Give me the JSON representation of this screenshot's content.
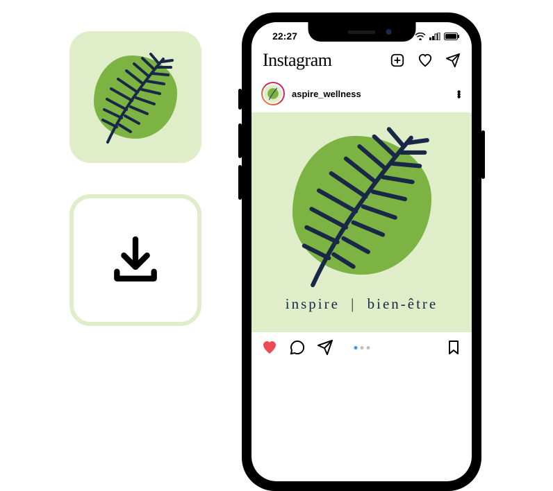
{
  "colors": {
    "tile_bg": "#dfedc9",
    "blob": "#7cb342",
    "leaf": "#1a2847",
    "heart": "#ed4956"
  },
  "logo_tile": {
    "alt": "leaf-logo"
  },
  "download_tile": {
    "label": "download"
  },
  "phone": {
    "status": {
      "time": "22:27"
    },
    "app": {
      "name": "Instagram"
    },
    "post": {
      "username": "aspire_wellness",
      "caption_left": "inspire",
      "caption_divider": "|",
      "caption_right": "bien-être",
      "carousel": {
        "count": 3,
        "active_index": 0
      }
    }
  }
}
